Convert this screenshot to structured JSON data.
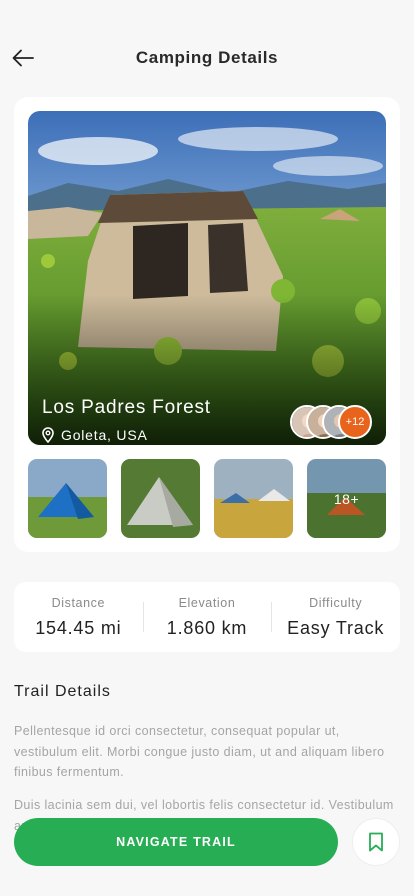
{
  "header": {
    "title": "Camping Details",
    "back_icon": "arrow-left-icon"
  },
  "hero": {
    "title": "Los Padres Forest",
    "location": "Goleta, USA",
    "location_icon": "map-pin-icon",
    "extra_members": "+12"
  },
  "thumbnails": {
    "more_label": "18+"
  },
  "stats": [
    {
      "label": "Distance",
      "value": "154.45 mi"
    },
    {
      "label": "Elevation",
      "value": "1.860 km"
    },
    {
      "label": "Difficulty",
      "value": "Easy Track"
    }
  ],
  "trail": {
    "title": "Trail Details",
    "paragraph1": "Pellentesque id orci consectetur, consequat popular ut, vestibulum elit. Morbi congue justo diam, ut and aliquam libero finibus fermentum.",
    "paragraph2": "Duis lacinia sem dui, vel lobortis felis consectetur id. Vestibulum ante ipsum primis in faucibus orci efficitur"
  },
  "actions": {
    "navigate_label": "NAVIGATE TRAIL",
    "bookmark_icon": "bookmark-icon"
  },
  "colors": {
    "primary": "#27ae55",
    "badge": "#e8641c"
  }
}
